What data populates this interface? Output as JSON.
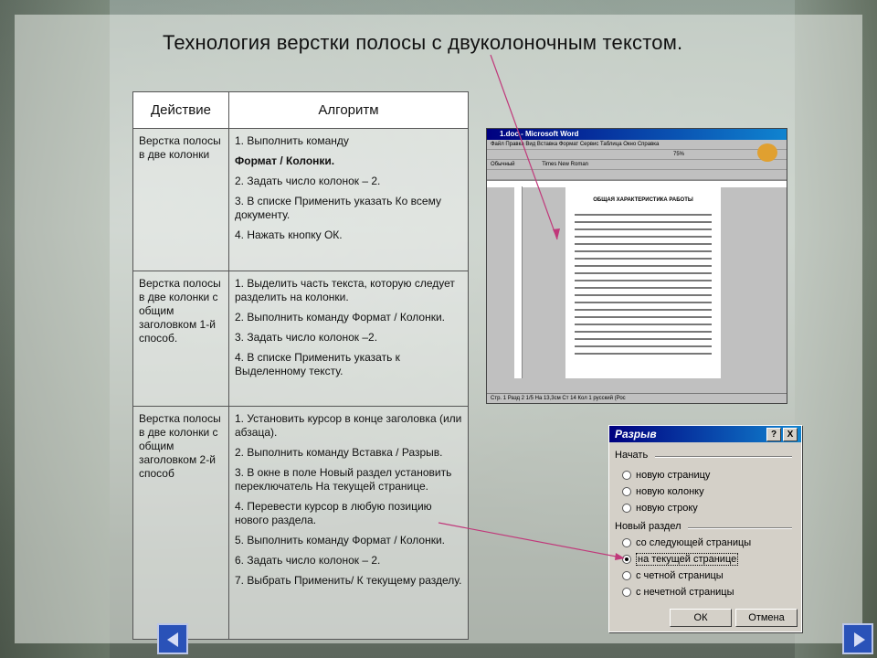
{
  "title": "Технология верстки полосы с двуколоночным текстом.",
  "table": {
    "headers": [
      "Действие",
      "Алгоритм"
    ],
    "rows": [
      {
        "action": "Верстка полосы в две колонки",
        "steps": [
          "1. Выполнить команду",
          "Формат / Колонки.",
          "2. Задать число колонок – 2.",
          "3. В списке Применить указать Ко всему документу.",
          "4. Нажать кнопку ОК."
        ]
      },
      {
        "action": "Верстка полосы в две колонки с общим заголовком 1-й способ.",
        "steps": [
          "1. Выделить часть текста, которую следует разделить на колонки.",
          "2. Выполнить команду Формат / Колонки.",
          "3. Задать число колонок –2.",
          "4. В списке Применить указать к Выделенному тексту."
        ]
      },
      {
        "action": "Верстка полосы в две колонки с общим заголовком 2-й способ",
        "steps": [
          "1. Установить курсор в конце заголовка (или абзаца).",
          "2. Выполнить команду Вставка / Разрыв.",
          "3. В окне в поле Новый раздел установить переключатель На текущей странице.",
          "4. Перевести курсор в любую позицию нового раздела.",
          "5. Выполнить команду Формат / Колонки.",
          "6. Задать число колонок – 2.",
          "7. Выбрать Применить/ К текущему разделу."
        ]
      }
    ]
  },
  "word_window": {
    "title": "1.doc - Microsoft Word",
    "menu": "Файл  Правка  Вид  Вставка  Формат  Сервис  Таблица  Окно  Справка",
    "style": "Обычный",
    "font": "Times New Roman",
    "zoom": "75%",
    "doc_heading": "ОБЩАЯ ХАРАКТЕРИСТИКА РАБОТЫ",
    "status": "Стр. 1   Разд 2   1/5   На 13,3см  Ст 14  Кол 1   русский (Рос"
  },
  "dialog": {
    "title": "Разрыв",
    "help": "?",
    "close": "X",
    "group1": "Начать",
    "group1_options": [
      "новую страницу",
      "новую колонку",
      "новую строку"
    ],
    "group2": "Новый раздел",
    "group2_options": [
      "со следующей страницы",
      "на текущей странице",
      "с четной страницы",
      "с нечетной страницы"
    ],
    "selected_option": "на текущей странице",
    "ok": "ОК",
    "cancel": "Отмена"
  }
}
